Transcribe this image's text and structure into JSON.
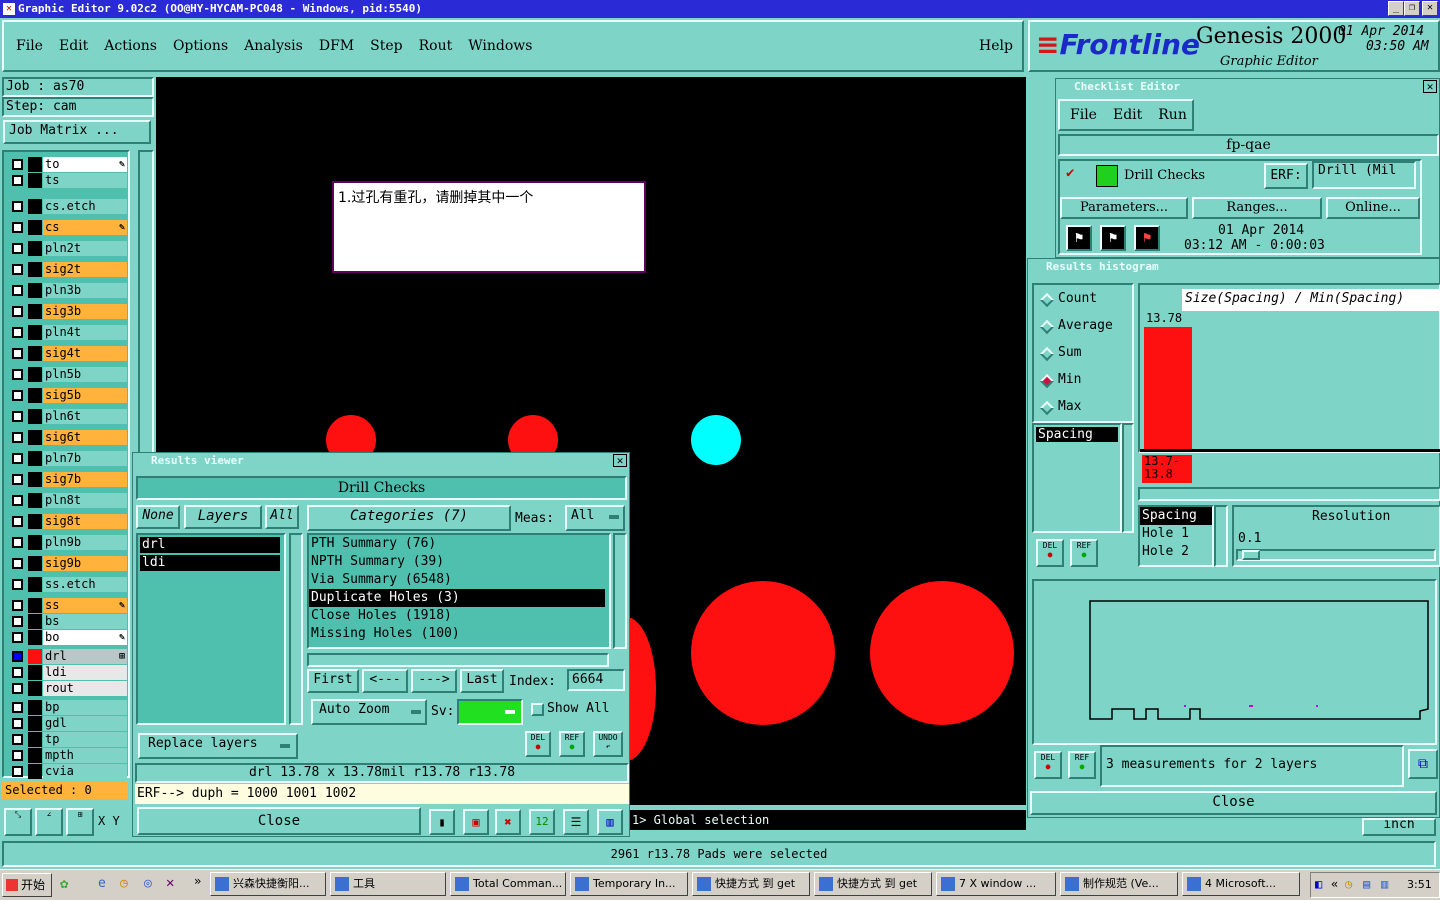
{
  "window": {
    "title": "Graphic Editor 9.02c2 (OO@HY-HYCAM-PC048 - Windows, pid:5540)"
  },
  "menu": [
    "File",
    "Edit",
    "Actions",
    "Options",
    "Analysis",
    "DFM",
    "Step",
    "Rout",
    "Windows"
  ],
  "help": "Help",
  "brand": {
    "logo": "Frontline",
    "product": "Genesis 2000",
    "subtitle": "Graphic Editor",
    "date": "01 Apr 2014",
    "time": "03:50 AM"
  },
  "job": {
    "job": "Job : as70",
    "step": "Step: cam",
    "matrix": "Job Matrix ..."
  },
  "layers": [
    {
      "name": "to",
      "color": "#ffffff",
      "flag": true
    },
    {
      "name": "ts",
      "color": "#7fd4c8"
    },
    {
      "name": "cs.etch",
      "color": "#7fd4c8"
    },
    {
      "name": "cs",
      "color": "#ffb23c",
      "flag": true
    },
    {
      "name": "pln2t",
      "color": "#7fd4c8"
    },
    {
      "name": "sig2t",
      "color": "#ffb23c"
    },
    {
      "name": "pln3b",
      "color": "#7fd4c8"
    },
    {
      "name": "sig3b",
      "color": "#ffb23c"
    },
    {
      "name": "pln4t",
      "color": "#7fd4c8"
    },
    {
      "name": "sig4t",
      "color": "#ffb23c"
    },
    {
      "name": "pln5b",
      "color": "#7fd4c8"
    },
    {
      "name": "sig5b",
      "color": "#ffb23c"
    },
    {
      "name": "pln6t",
      "color": "#7fd4c8"
    },
    {
      "name": "sig6t",
      "color": "#ffb23c"
    },
    {
      "name": "pln7b",
      "color": "#7fd4c8"
    },
    {
      "name": "sig7b",
      "color": "#ffb23c"
    },
    {
      "name": "pln8t",
      "color": "#7fd4c8"
    },
    {
      "name": "sig8t",
      "color": "#ffb23c"
    },
    {
      "name": "pln9b",
      "color": "#7fd4c8"
    },
    {
      "name": "sig9b",
      "color": "#ffb23c"
    },
    {
      "name": "ss.etch",
      "color": "#7fd4c8"
    },
    {
      "name": "ss",
      "color": "#ffb23c",
      "flag": true
    },
    {
      "name": "bs",
      "color": "#7fd4c8"
    },
    {
      "name": "bo",
      "color": "#ffffff",
      "flag": true
    },
    {
      "name": "drl",
      "color": "#b8c8c8",
      "active": true
    },
    {
      "name": "ldi",
      "color": "#e8e8e8"
    },
    {
      "name": "rout",
      "color": "#e8e8e8"
    },
    {
      "name": "bp",
      "color": "#7fd4c8"
    },
    {
      "name": "gdl",
      "color": "#7fd4c8"
    },
    {
      "name": "tp",
      "color": "#7fd4c8"
    },
    {
      "name": "mpth",
      "color": "#7fd4c8"
    },
    {
      "name": "cvia",
      "color": "#7fd4c8"
    }
  ],
  "selected": "Selected : 0",
  "xy": "X Y",
  "note": "1.过孔有重孔，请删掉其中一个",
  "results_viewer": {
    "title": "Results viewer",
    "header": "Drill Checks",
    "none": "None",
    "layers": "Layers",
    "all": "All",
    "layer_list": [
      "drl",
      "ldi"
    ],
    "categories": "Categories (7)",
    "meas_label": "Meas:",
    "meas_value": "All",
    "cat_list": [
      "PTH Summary (76)",
      "NPTH Summary (39)",
      "Via Summary (6548)",
      "Duplicate Holes (3)",
      "Close Holes (1918)",
      "Missing Holes (100)"
    ],
    "first": "First",
    "prev": "<---",
    "next": "--->",
    "last": "Last",
    "index_label": "Index:",
    "index_value": "6664",
    "autozoom": "Auto Zoom",
    "sv": "Sv:",
    "showall": "Show All",
    "replace": "Replace layers",
    "del": "DEL",
    "ref": "REF",
    "undo": "UNDO",
    "info": "drl  13.78 x 13.78mil  r13.78  r13.78",
    "erf": "ERF--> duph = 1000 1001 1002",
    "close": "Close"
  },
  "checklist": {
    "title": "Checklist Editor",
    "menu": [
      "File",
      "Edit",
      "Run"
    ],
    "name": "fp-qae",
    "check": "Drill Checks",
    "erf_label": "ERF:",
    "erf_value": "Drill (Mil",
    "params": "Parameters...",
    "ranges": "Ranges...",
    "online": "Online...",
    "date": "01 Apr 2014",
    "time": "03:12 AM - 0:00:03"
  },
  "histogram": {
    "title": "Results histogram",
    "modes": [
      "Count",
      "Average",
      "Sum",
      "Min",
      "Max"
    ],
    "selected_mode": "Min",
    "field": "Spacing",
    "axis_title": "Size(Spacing) / Min(Spacing)",
    "bar_value": "13.78",
    "bar_range": "13.7-\n13.8",
    "table": [
      "Spacing",
      "Hole 1",
      "Hole 2"
    ],
    "resolution": "Resolution",
    "res_value": "0.1",
    "measurements": "3 measurements for 2 layers",
    "close": "Close"
  },
  "status_cmd": "1> Global selection",
  "units": "inch",
  "status": "2961 r13.78 Pads were selected",
  "taskbar": {
    "start": "开始",
    "items": [
      "兴森快捷衡阳...",
      "工具",
      "Total Comman...",
      "Temporary In...",
      "快捷方式 到 get",
      "快捷方式 到 get",
      "7 X window ...",
      "制作规范 (Ve...",
      "4 Microsoft..."
    ],
    "clock": "3:51"
  },
  "colors": {
    "red": "#ff1010",
    "cyan": "#00ffff",
    "teal": "#7fd4c8"
  }
}
